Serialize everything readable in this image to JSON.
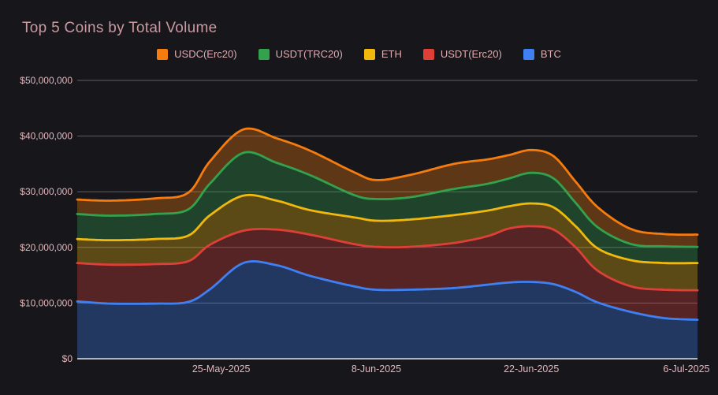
{
  "page": {
    "background_color": "#17171b",
    "title_color": "#cb9aa0",
    "tick_label_color": "#e3b6bb",
    "legend_label_color": "#dcaeb4",
    "gridline_color": "#5e5e64",
    "baseline_color": "#aeb6c6"
  },
  "header": {
    "title": "Top 5 Coins by Total Volume"
  },
  "chart_data": {
    "type": "area",
    "stacked": true,
    "title": "Top 5 Coins by Total Volume",
    "legend_position": "top",
    "legend_order_top_series_first": [
      "USDC(Erc20)",
      "USDT(TRC20)",
      "ETH",
      "USDT(Erc20)",
      "BTC"
    ],
    "x_axis": {
      "kind": "time",
      "domain_days": [
        0,
        56
      ],
      "sample_days": [
        0,
        3,
        7,
        10,
        12,
        15,
        18,
        21,
        25,
        27,
        30,
        34,
        37,
        39,
        41,
        43,
        45,
        47,
        50,
        53,
        56
      ],
      "ticks": [
        {
          "day": 13,
          "label": "25-May-2025"
        },
        {
          "day": 27,
          "label": "8-Jun-2025"
        },
        {
          "day": 41,
          "label": "22-Jun-2025"
        },
        {
          "day": 55,
          "label": "6-Jul-2025"
        }
      ]
    },
    "y_axis": {
      "unit": "USD",
      "lim_million": [
        0,
        50
      ],
      "grid": true,
      "ticks": [
        {
          "value_million": 0,
          "label": "$0"
        },
        {
          "value_million": 10,
          "label": "$10,000,000"
        },
        {
          "value_million": 20,
          "label": "$20,000,000"
        },
        {
          "value_million": 30,
          "label": "$30,000,000"
        },
        {
          "value_million": 40,
          "label": "$40,000,000"
        },
        {
          "value_million": 50,
          "label": "$50,000,000"
        }
      ]
    },
    "series_bottom_to_top": [
      {
        "name": "BTC",
        "color": "#3f80f2",
        "values_million": [
          10.3,
          9.9,
          9.9,
          10.2,
          12.5,
          17.2,
          16.8,
          14.9,
          13.0,
          12.4,
          12.4,
          12.7,
          13.3,
          13.7,
          13.8,
          13.4,
          12.0,
          10.1,
          8.4,
          7.3,
          7.0
        ]
      },
      {
        "name": "USDT(Erc20)",
        "color": "#de4038",
        "values_million": [
          6.9,
          7.0,
          7.1,
          7.3,
          8.0,
          5.8,
          6.4,
          7.4,
          7.6,
          7.7,
          7.7,
          8.1,
          8.7,
          9.7,
          10.0,
          9.8,
          8.0,
          5.7,
          4.6,
          5.1,
          5.3
        ]
      },
      {
        "name": "ETH",
        "color": "#f0b90c",
        "values_million": [
          4.3,
          4.4,
          4.5,
          4.6,
          5.3,
          6.3,
          5.2,
          4.4,
          4.8,
          4.7,
          4.9,
          5.0,
          4.6,
          4.0,
          4.1,
          4.0,
          3.8,
          4.0,
          4.7,
          4.8,
          4.9
        ]
      },
      {
        "name": "USDT(TRC20)",
        "color": "#34a14d",
        "values_million": [
          4.5,
          4.4,
          4.5,
          4.7,
          5.7,
          7.7,
          6.8,
          6.3,
          4.0,
          3.9,
          4.0,
          4.7,
          4.8,
          5.0,
          5.5,
          5.2,
          4.2,
          3.8,
          2.9,
          3.0,
          2.9
        ]
      },
      {
        "name": "USDC(Erc20)",
        "color": "#f57c0d",
        "values_million": [
          2.6,
          2.7,
          2.8,
          3.0,
          4.0,
          4.2,
          4.4,
          4.4,
          4.1,
          3.4,
          4.0,
          4.5,
          4.4,
          4.2,
          4.1,
          4.0,
          3.8,
          3.6,
          2.7,
          2.2,
          2.2
        ]
      }
    ],
    "fill_opacity": 0.32,
    "stroke_width": 2.8
  }
}
